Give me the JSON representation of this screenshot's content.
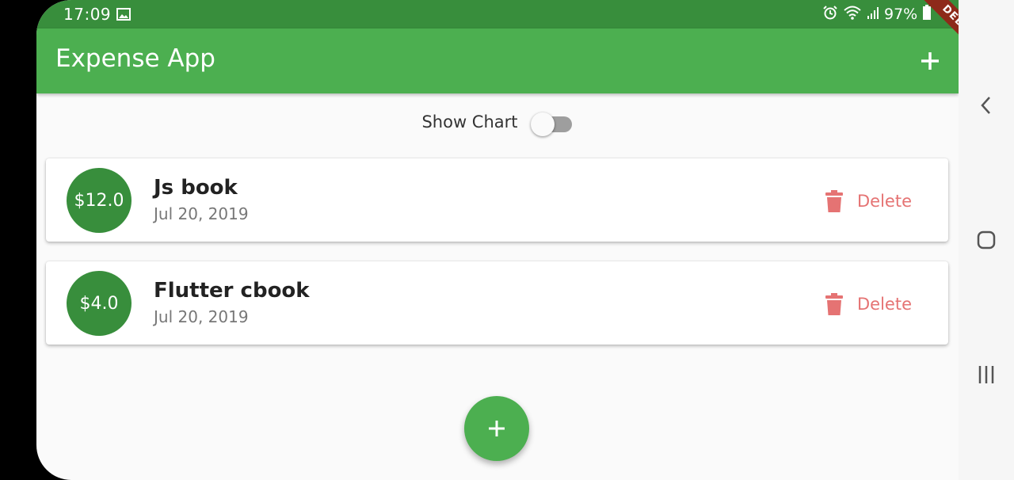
{
  "status_bar": {
    "time": "17:09",
    "battery": "97%",
    "icons": [
      "gallery-icon",
      "alarm-icon",
      "wifi-icon",
      "signal-icon",
      "battery-icon"
    ]
  },
  "app_bar": {
    "title": "Expense App",
    "add_icon": "plus-icon",
    "debug_banner": "DEBUG",
    "color": "#4caf50"
  },
  "toggle": {
    "label": "Show Chart",
    "on": false
  },
  "transactions": [
    {
      "amount": "$12.0",
      "title": "Js book",
      "date": "Jul 20, 2019",
      "delete_label": "Delete"
    },
    {
      "amount": "$4.0",
      "title": "Flutter cbook",
      "date": "Jul 20, 2019",
      "delete_label": "Delete"
    }
  ],
  "fab": {
    "icon": "plus-icon"
  },
  "nav_bar": {
    "buttons": [
      "back-icon",
      "home-icon",
      "recents-icon"
    ]
  },
  "colors": {
    "primary": "#4caf50",
    "primary_dark": "#388e3c",
    "delete": "#e57373"
  }
}
